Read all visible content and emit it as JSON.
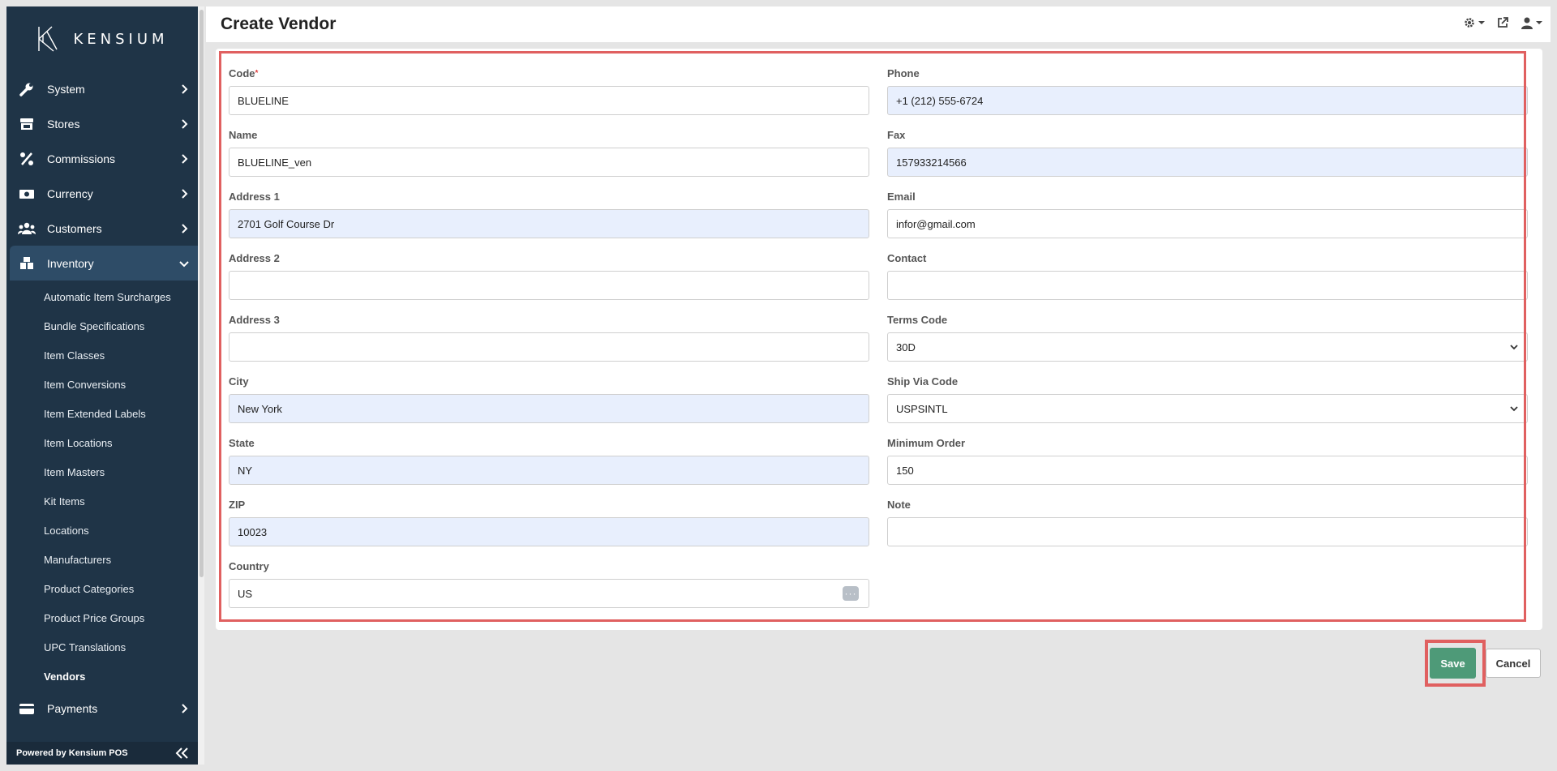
{
  "brand": {
    "name": "KENSIUM",
    "footer": "Powered by Kensium POS"
  },
  "header": {
    "title": "Create Vendor"
  },
  "sidebar": {
    "items": [
      {
        "label": "System",
        "icon": "wrench-icon"
      },
      {
        "label": "Stores",
        "icon": "store-icon"
      },
      {
        "label": "Commissions",
        "icon": "percent-icon"
      },
      {
        "label": "Currency",
        "icon": "money-icon"
      },
      {
        "label": "Customers",
        "icon": "users-icon"
      },
      {
        "label": "Inventory",
        "icon": "boxes-icon"
      }
    ],
    "inventory_items": [
      "Automatic Item Surcharges",
      "Bundle Specifications",
      "Item Classes",
      "Item Conversions",
      "Item Extended Labels",
      "Item Locations",
      "Item Masters",
      "Kit Items",
      "Locations",
      "Manufacturers",
      "Product Categories",
      "Product Price Groups",
      "UPC Translations",
      "Vendors"
    ],
    "after": {
      "label": "Payments",
      "icon": "credit-card-icon"
    }
  },
  "form": {
    "left": [
      {
        "label": "Code",
        "value": "BLUELINE",
        "required": true,
        "filled": false
      },
      {
        "label": "Name",
        "value": "BLUELINE_ven",
        "filled": false
      },
      {
        "label": "Address 1",
        "value": "2701 Golf Course Dr",
        "filled": true
      },
      {
        "label": "Address 2",
        "value": "",
        "filled": false
      },
      {
        "label": "Address 3",
        "value": "",
        "filled": false
      },
      {
        "label": "City",
        "value": "New York",
        "filled": true
      },
      {
        "label": "State",
        "value": "NY",
        "filled": true
      },
      {
        "label": "ZIP",
        "value": "10023",
        "filled": true
      },
      {
        "label": "Country",
        "value": "US",
        "filled": false,
        "lookup": true
      }
    ],
    "right": [
      {
        "label": "Phone",
        "value": "+1 (212) 555-6724",
        "filled": true
      },
      {
        "label": "Fax",
        "value": "157933214566",
        "filled": true
      },
      {
        "label": "Email",
        "value": "infor@gmail.com",
        "filled": false
      },
      {
        "label": "Contact",
        "value": "",
        "filled": false
      },
      {
        "label": "Terms Code",
        "value": "30D",
        "filled": false,
        "select": true
      },
      {
        "label": "Ship Via Code",
        "value": "USPSINTL",
        "filled": false,
        "select": true
      },
      {
        "label": "Minimum Order",
        "value": "150",
        "filled": false
      },
      {
        "label": "Note",
        "value": "",
        "filled": false
      }
    ]
  },
  "actions": {
    "save": "Save",
    "cancel": "Cancel"
  },
  "colors": {
    "sidebar": "#1f3447",
    "save": "#4e9a78",
    "highlight": "#e06060",
    "filled_field": "#e8effd"
  }
}
